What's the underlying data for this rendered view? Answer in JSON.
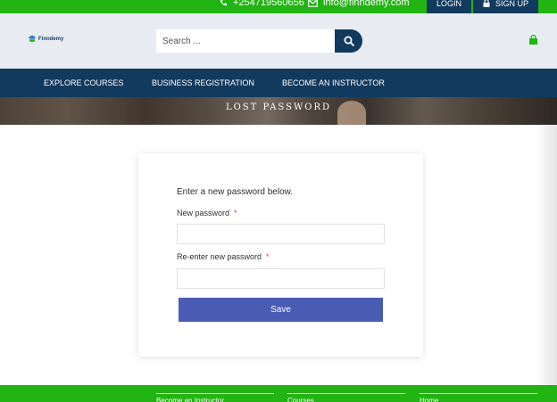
{
  "topbar": {
    "phone": "+254719560656",
    "email": "info@finndemy.com",
    "login_label": "LOGIN",
    "signup_label": "SIGN UP",
    "icons": [
      "phone-icon",
      "mail-icon",
      "lock-icon"
    ]
  },
  "header": {
    "logo_text": "Finndemy",
    "search_placeholder": "Search ...",
    "icons": [
      "search-icon",
      "cart-icon"
    ]
  },
  "nav": {
    "items": [
      "EXPLORE COURSES",
      "BUSINESS REGISTRATION",
      "BECOME AN INSTRUCTOR"
    ]
  },
  "banner": {
    "title": "LOST PASSWORD"
  },
  "form": {
    "intro": "Enter a new password below.",
    "new_password_label": "New password",
    "reenter_label": "Re-enter new password",
    "required_mark": "*",
    "save_label": "Save"
  },
  "footer": {
    "columns": [
      "Become an Instructor",
      "Courses",
      "Home"
    ]
  },
  "colors": {
    "green": "#22b413",
    "navy": "#123a5e",
    "button_blue": "#4a5bb4",
    "required_red": "#e03a3a"
  }
}
